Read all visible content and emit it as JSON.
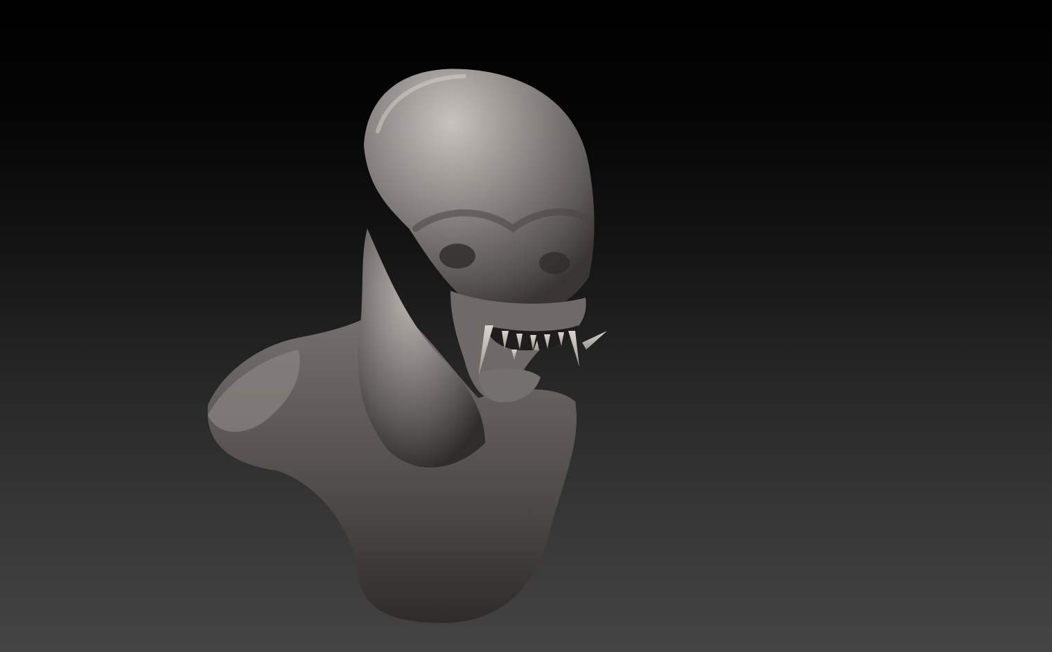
{
  "viewport": {
    "background_top_color": "#000000",
    "background_bottom_color": "#444444"
  },
  "model": {
    "material_color": "#8a8582",
    "highlight_color": "#c9c4c0",
    "shadow_color": "#2c2a29",
    "tooth_color": "#c4beb7"
  }
}
